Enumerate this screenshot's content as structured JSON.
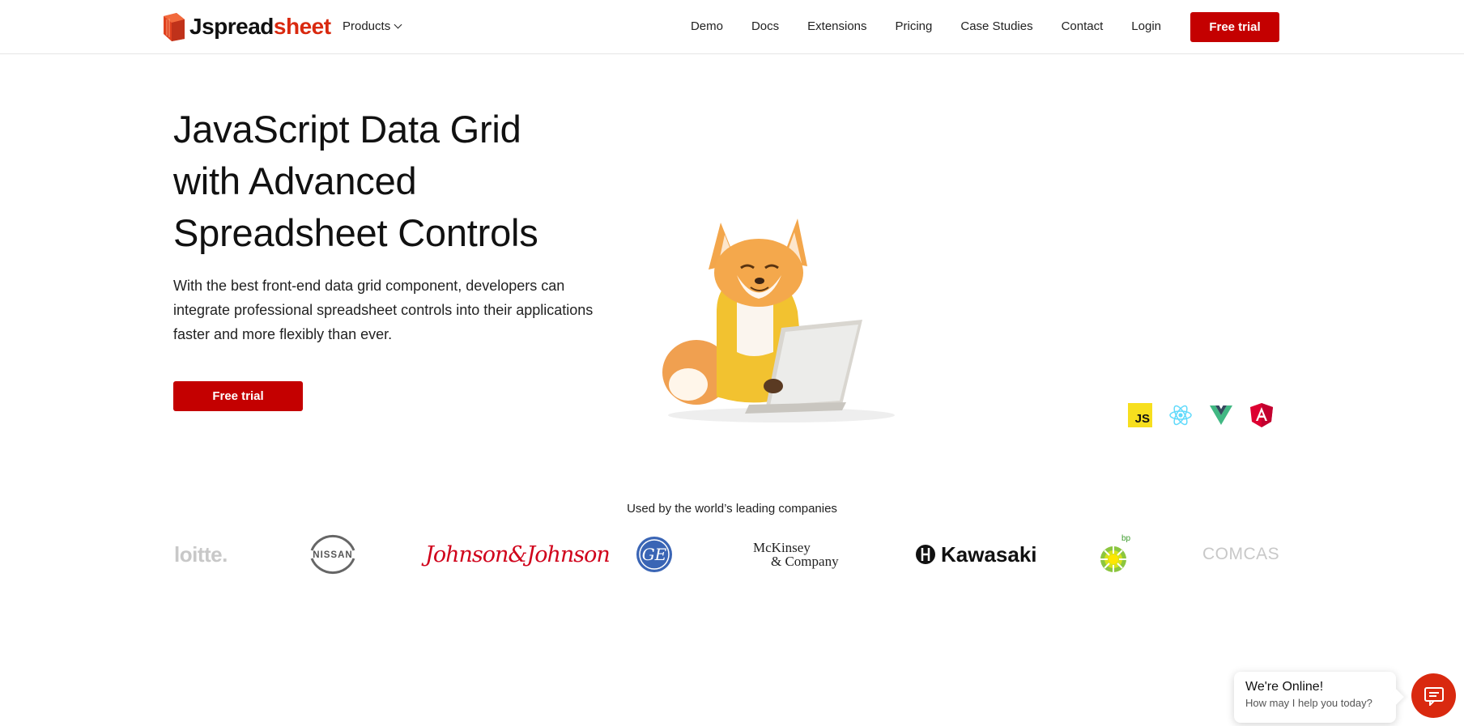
{
  "brand": {
    "name_prefix": "J",
    "name_main": "spread",
    "name_accent": "sheet",
    "accent_color": "#d9290f",
    "cta_color": "#c40000"
  },
  "header": {
    "products_label": "Products",
    "nav": [
      "Demo",
      "Docs",
      "Extensions",
      "Pricing",
      "Case Studies",
      "Contact",
      "Login"
    ],
    "cta_label": "Free trial"
  },
  "hero": {
    "title_line1": "JavaScript Data Grid",
    "title_line2": "with Advanced",
    "title_line3": "Spreadsheet Controls",
    "subtitle": "With the best front-end data grid component, developers can integrate professional spreadsheet controls into their applications faster and more flexibly than ever.",
    "cta_label": "Free trial",
    "frameworks": [
      {
        "icon": "javascript-icon",
        "label": "JS"
      },
      {
        "icon": "react-icon"
      },
      {
        "icon": "vue-icon"
      },
      {
        "icon": "angular-icon"
      }
    ]
  },
  "companies": {
    "label": "Used by the world’s leading companies",
    "deloitte": "loitte.",
    "nissan": "NISSAN",
    "jj": "Johnson&Johnson",
    "ge": "GE",
    "mckinsey_line1": "McKinsey",
    "mckinsey_line2": "& Company",
    "kawasaki": "Kawasaki",
    "bp": "bp",
    "comcast": "COMCAST"
  },
  "chat": {
    "title": "We're Online!",
    "subtitle": "How may I help you today?"
  }
}
